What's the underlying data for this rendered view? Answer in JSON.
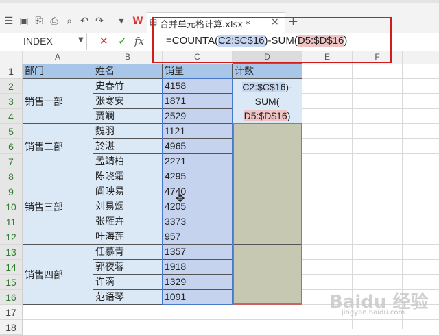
{
  "file_tab": {
    "name": "合并单元格计算.xlsx *",
    "close": "×",
    "new_tab": "+"
  },
  "formula_bar": {
    "name_box": "INDEX",
    "cancel_glyph": "✕",
    "enter_glyph": "✓",
    "fx_label": "fx",
    "formula": {
      "prefix": "=COUNTA(",
      "ref1": "C2:$C$16",
      "middle": ")-SUM(",
      "ref2": "D5:$D$16",
      "suffix": ")"
    }
  },
  "columns": [
    "A",
    "B",
    "C",
    "D",
    "E",
    "F"
  ],
  "rows": [
    "1",
    "2",
    "3",
    "4",
    "5",
    "6",
    "7",
    "8",
    "9",
    "10",
    "11",
    "12",
    "13",
    "14",
    "15",
    "16",
    "17",
    "18"
  ],
  "table": {
    "headers": [
      "部门",
      "姓名",
      "销量",
      "计数"
    ],
    "departments": [
      "销售一部",
      "销售二部",
      "销售三部",
      "销售四部"
    ],
    "records": [
      {
        "name": "史春竹",
        "sales": "4158"
      },
      {
        "name": "张寒安",
        "sales": "1871"
      },
      {
        "name": "贾斓",
        "sales": "2529"
      },
      {
        "name": "魏羽",
        "sales": "1121"
      },
      {
        "name": "於湛",
        "sales": "4965"
      },
      {
        "name": "孟靖柏",
        "sales": "2271"
      },
      {
        "name": "陈晓霜",
        "sales": "4295"
      },
      {
        "name": "阎映易",
        "sales": "4740"
      },
      {
        "name": "刘易烟",
        "sales": "4205"
      },
      {
        "name": "张雁卉",
        "sales": "3373"
      },
      {
        "name": "叶海莲",
        "sales": "957"
      },
      {
        "name": "任慕青",
        "sales": "1357"
      },
      {
        "name": "郭夜蓉",
        "sales": "1918"
      },
      {
        "name": "许滴",
        "sales": "1329"
      },
      {
        "name": "范语琴",
        "sales": "1091"
      }
    ],
    "count_first_cell": {
      "line1": "C2:$C$16",
      "line2": ")-",
      "line3": "SUM(",
      "line4": "D5:$D$16",
      "line5": ")"
    }
  },
  "watermark": {
    "brand": "Baidu 经验",
    "url": "jingyan.baidu.com"
  },
  "colors": {
    "header_fill": "#a8c7e8",
    "dept_fill": "#dbe8f5",
    "sales_fill": "#c5d3ee",
    "count_fill": "#c7c8b2",
    "highlight_box": "#d21b1b"
  }
}
